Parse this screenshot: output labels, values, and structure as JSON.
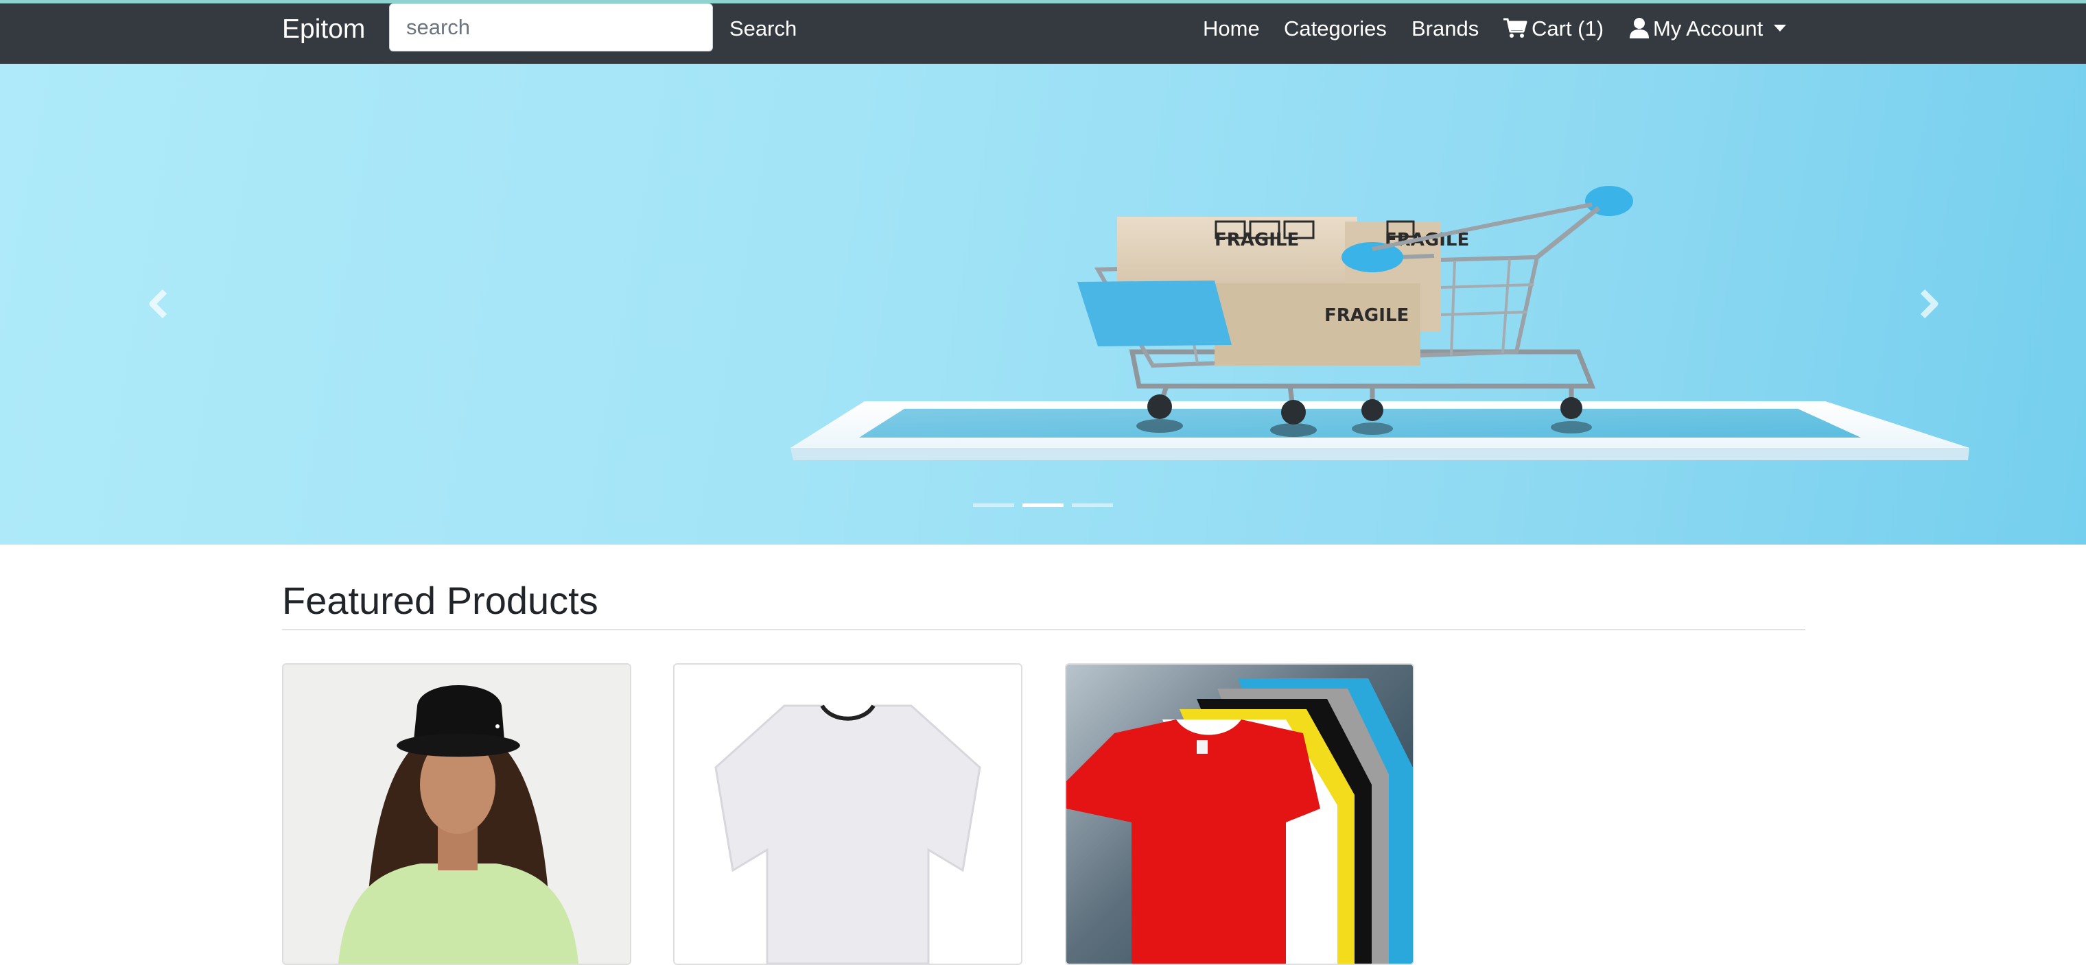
{
  "navbar": {
    "brand": "Epitom",
    "search": {
      "placeholder": "search",
      "value": "",
      "button_label": "Search"
    },
    "links": {
      "home": "Home",
      "categories": "Categories",
      "brands": "Brands",
      "cart": "Cart (1)",
      "account": "My Account"
    },
    "icons": {
      "cart": "shopping-cart-icon",
      "account": "user-icon",
      "account_caret": "caret-down-icon"
    }
  },
  "carousel": {
    "slide_count": 3,
    "active_slide": 2,
    "controls": {
      "prev": "chevron-left-icon",
      "next": "chevron-right-icon"
    },
    "banner_text": [
      "FRAGILE",
      "FRAGILE",
      "FRAGILE"
    ]
  },
  "featured": {
    "title": "Featured Products",
    "products": [
      {
        "image": "woman-in-black-bucket-hat"
      },
      {
        "image": "white-t-shirt"
      },
      {
        "image": "stack-of-colored-t-shirts"
      }
    ]
  },
  "colors": {
    "navbar_bg": "#343a40",
    "banner_bg": "#a3e4f7",
    "cart_blue": "#3ab4e8"
  }
}
